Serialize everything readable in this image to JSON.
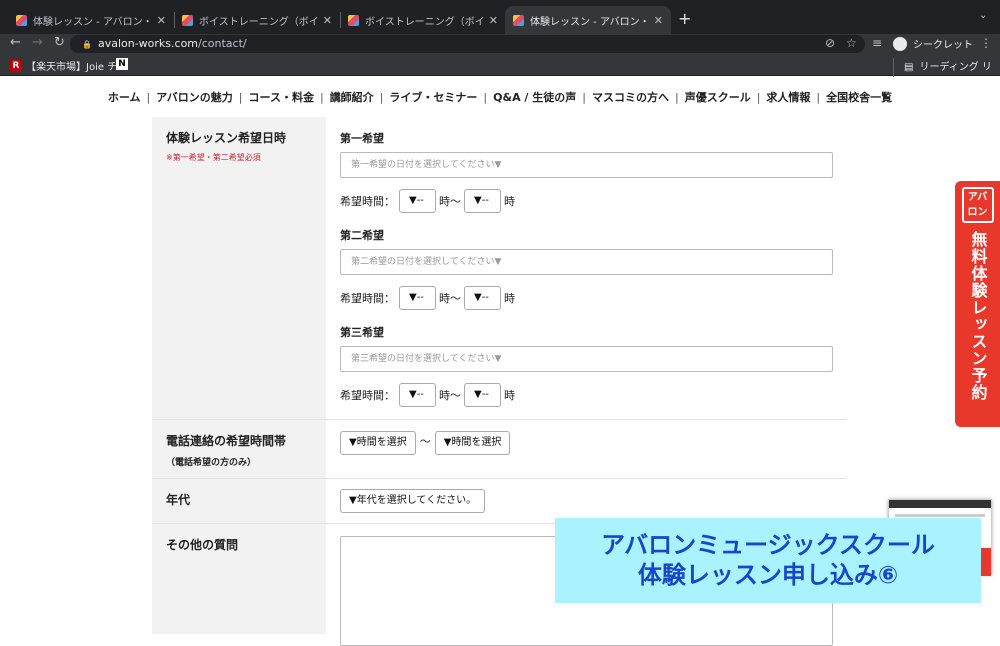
{
  "browser": {
    "tabs": [
      {
        "title": "体験レッスン - アバロン・ミュージ"
      },
      {
        "title": "ボイストレーニング（ボイトレ）の"
      },
      {
        "title": "ボイストレーニング（ボイトレ）の"
      },
      {
        "title": "体験レッスン - アバロン・ミュージ"
      }
    ],
    "url_host": "avalon-works.com",
    "url_path": "/contact/",
    "profile_label": "シークレット",
    "bookmarks": [
      {
        "label": "【楽天市場】Joie チ..."
      }
    ],
    "reading_list": "リーディング リスト"
  },
  "nav": {
    "items": [
      "ホーム",
      "アバロンの魅力",
      "コース・料金",
      "講師紹介",
      "ライブ・セミナー",
      "Q&A / 生徒の声",
      "マスコミの方へ",
      "声優スクール",
      "求人情報",
      "全国校舎一覧"
    ]
  },
  "form": {
    "lesson_date": {
      "label": "体験レッスン希望日時",
      "note": "※第一希望・第二希望必須",
      "choices": [
        {
          "title": "第一希望",
          "placeholder": "第一希望の日付を選択してください▼"
        },
        {
          "title": "第二希望",
          "placeholder": "第二希望の日付を選択してください▼"
        },
        {
          "title": "第三希望",
          "placeholder": "第三希望の日付を選択してください▼"
        }
      ],
      "time_label": "希望時間：",
      "hour_select": "▼--",
      "hour_suffix_tilde": "時〜",
      "hour_suffix": "時"
    },
    "phone_time": {
      "label": "電話連絡の希望時間帯",
      "sub": "（電話希望の方のみ）",
      "from_select": "▼時間を選択",
      "tilde": "〜",
      "to_select": "▼時間を選択"
    },
    "age": {
      "label": "年代",
      "select": "▼年代を選択してください。"
    },
    "other": {
      "label": "その他の質問"
    }
  },
  "side_banner": {
    "logo": "アバロン",
    "text": "無料体験レッスン予約"
  },
  "overlay": {
    "line1": "アバロンミュージックスクール",
    "line2": "体験レッスン申し込み⑥"
  }
}
